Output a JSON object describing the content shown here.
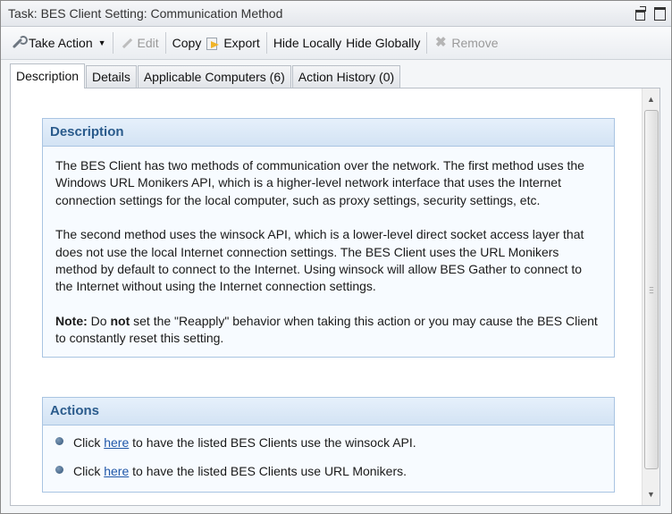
{
  "window": {
    "title": "Task: BES Client Setting: Communication Method"
  },
  "toolbar": {
    "take_action": "Take Action",
    "edit": "Edit",
    "copy": "Copy",
    "export": "Export",
    "hide_locally": "Hide Locally",
    "hide_globally": "Hide Globally",
    "remove": "Remove"
  },
  "tabs": [
    {
      "label": "Description",
      "active": true
    },
    {
      "label": "Details"
    },
    {
      "label": "Applicable Computers (6)"
    },
    {
      "label": "Action History (0)"
    }
  ],
  "description": {
    "heading": "Description",
    "para1": "The BES Client has two methods of communication over the network. The first method uses the Windows URL Monikers API, which is a higher-level network interface that uses the Internet connection settings for the local computer, such as proxy settings, security settings, etc.",
    "para2": "The second method uses the winsock API, which is a lower-level direct socket access layer that does not use the local Internet connection settings. The BES Client uses the URL Monikers method by default to connect to the Internet. Using winsock will allow BES Gather to connect to the Internet without using the Internet connection settings.",
    "note_label": "Note:",
    "note_pre": " Do ",
    "note_bold": "not",
    "note_post": " set the \"Reapply\" behavior when taking this action or you may cause the BES Client to constantly reset this setting."
  },
  "actions": {
    "heading": "Actions",
    "items": [
      {
        "pre": "Click ",
        "link": "here",
        "post": " to have the listed BES Clients use the winsock API."
      },
      {
        "pre": "Click ",
        "link": "here",
        "post": " to have the listed BES Clients use URL Monikers."
      }
    ]
  },
  "colors": {
    "panel_header_text": "#2a5b8c",
    "panel_border": "#a9c4e2",
    "link": "#1f56a8"
  }
}
